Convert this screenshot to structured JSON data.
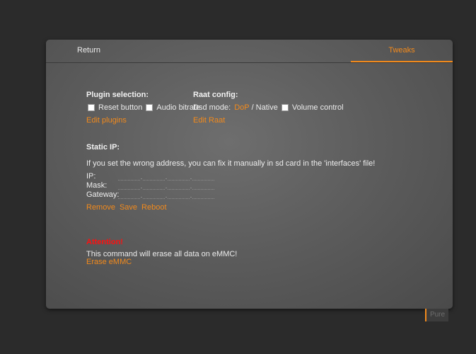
{
  "tabs": {
    "return_label": "Return",
    "tweaks_label": "Tweaks"
  },
  "plugin_selection": {
    "title": "Plugin selection:",
    "reset_button_label": "Reset button",
    "audio_bitrate_label": "Audio bitrate",
    "edit_link": "Edit plugins"
  },
  "raat_config": {
    "title": "Raat config:",
    "dsd_mode_label": "Dsd mode:",
    "dop_option": "DoP",
    "separator": "/",
    "native_option": "Native",
    "volume_control_label": "Volume control",
    "edit_link": "Edit Raat"
  },
  "static_ip": {
    "title": "Static IP:",
    "help_text": "If you set the wrong address, you can fix it manually in sd card in the 'interfaces' file!",
    "ip_label": "IP:",
    "mask_label": "Mask:",
    "gateway_label": "Gateway:",
    "octet_separator": ".",
    "remove_link": "Remove",
    "save_link": "Save",
    "reboot_link": "Reboot"
  },
  "emmc": {
    "attention_label": "Attention!",
    "warning_text": "This command will erase all data on eMMC!",
    "erase_link": "Erase eMMC"
  },
  "footer": {
    "badge_label": "Pure"
  },
  "colors": {
    "accent": "#f28a1c",
    "warning": "#ff1010",
    "background": "#2b2b2b"
  }
}
